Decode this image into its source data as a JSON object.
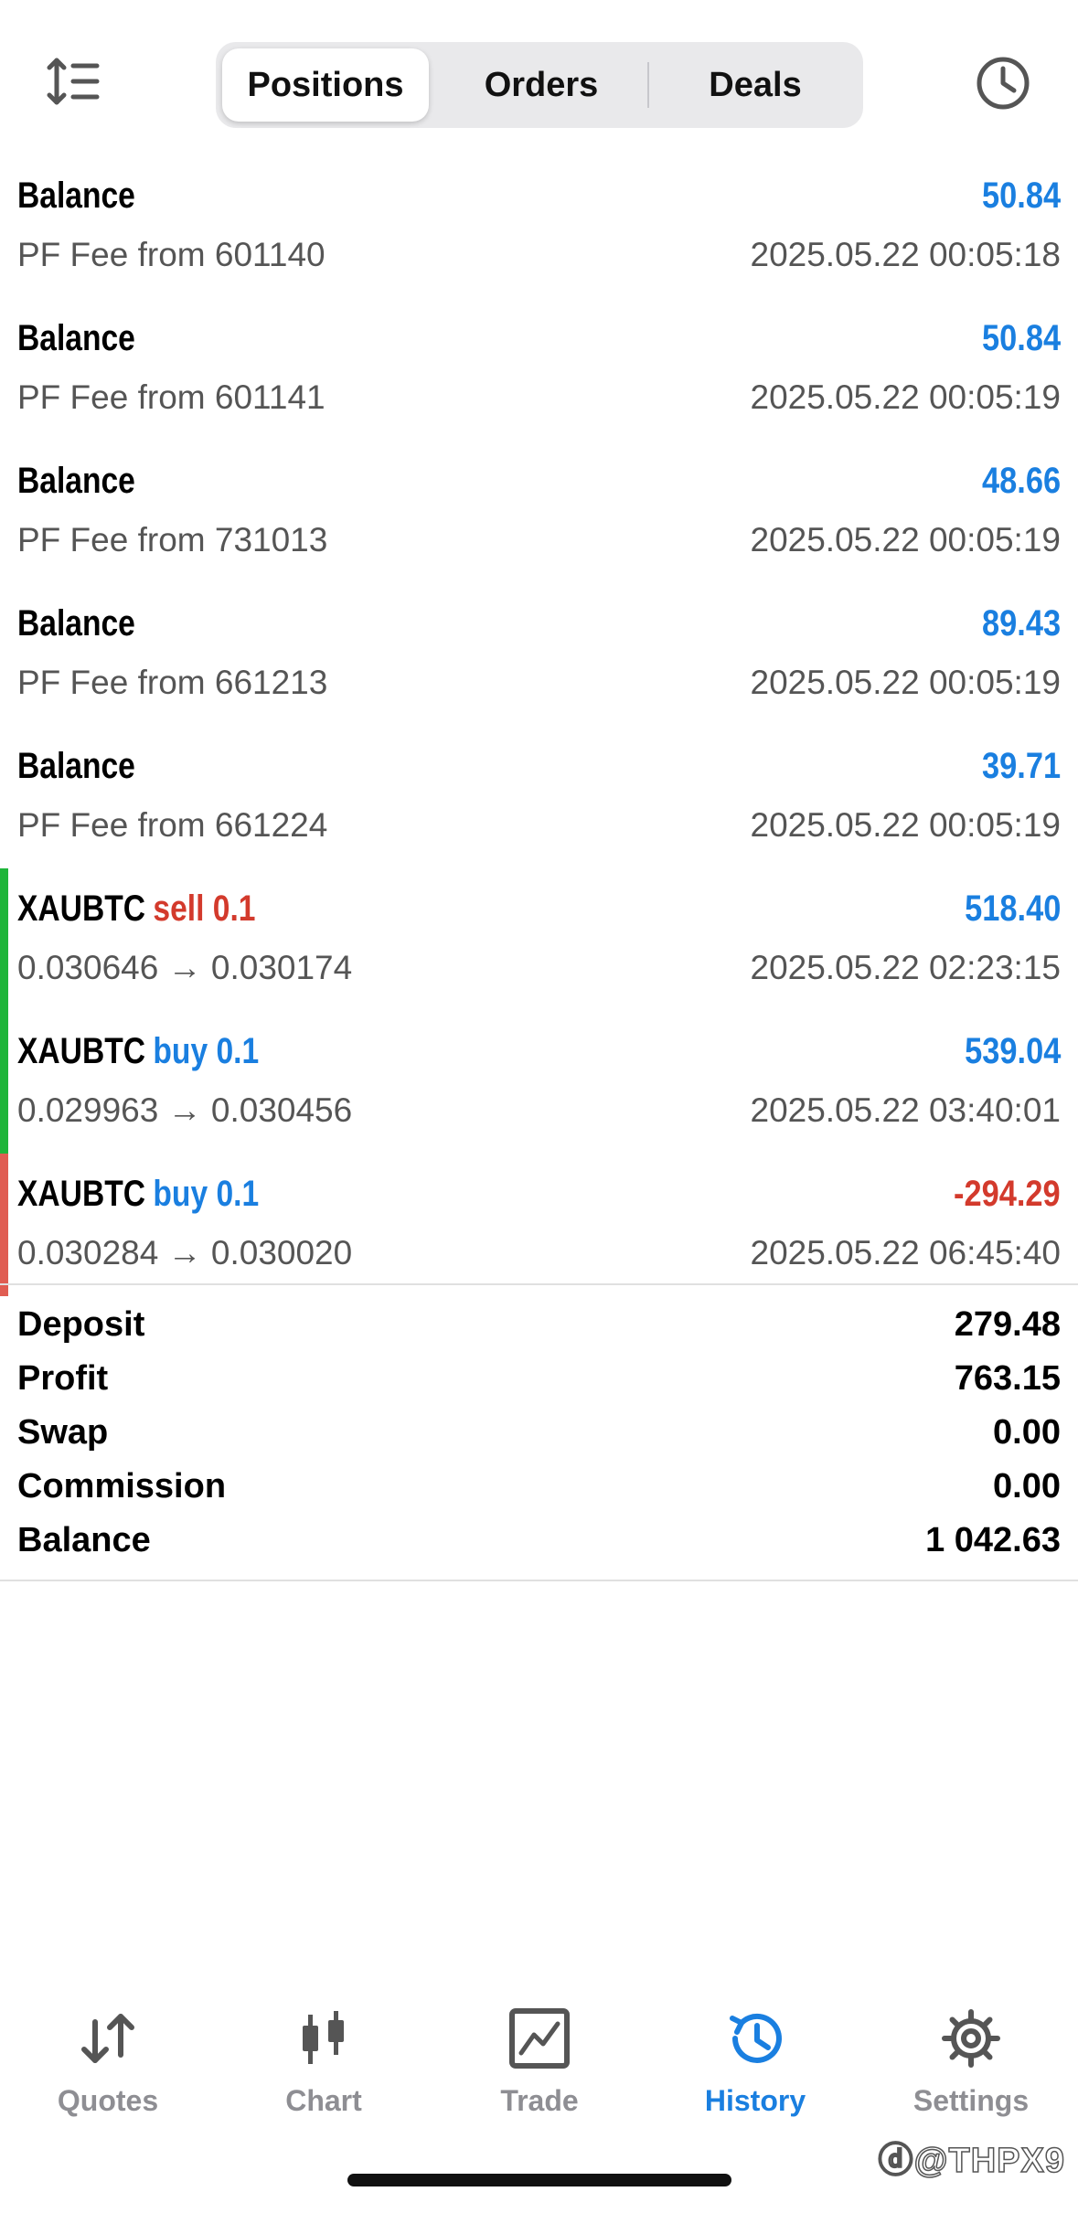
{
  "tabs": [
    {
      "label": "Positions",
      "active": true
    },
    {
      "label": "Orders",
      "active": false
    },
    {
      "label": "Deals",
      "active": false
    }
  ],
  "rows": [
    {
      "title": "Balance",
      "sub": "PF Fee from 601140",
      "amount": "50.84",
      "time": "2025.05.22 00:05:18"
    },
    {
      "title": "Balance",
      "sub": "PF Fee from 601141",
      "amount": "50.84",
      "time": "2025.05.22 00:05:19"
    },
    {
      "title": "Balance",
      "sub": "PF Fee from 731013",
      "amount": "48.66",
      "time": "2025.05.22 00:05:19"
    },
    {
      "title": "Balance",
      "sub": "PF Fee from 661213",
      "amount": "89.43",
      "time": "2025.05.22 00:05:19"
    },
    {
      "title": "Balance",
      "sub": "PF Fee from 661224",
      "amount": "39.71",
      "time": "2025.05.22 00:05:19"
    },
    {
      "title": "XAUBTC",
      "side": "sell 0.1",
      "sub": "0.030646 → 0.030174",
      "amount": "518.40",
      "time": "2025.05.22 02:23:15"
    },
    {
      "title": "XAUBTC",
      "side": "buy 0.1",
      "sub": "0.029963 → 0.030456",
      "amount": "539.04",
      "time": "2025.05.22 03:40:01"
    },
    {
      "title": "XAUBTC",
      "side": "buy 0.1",
      "sub": "0.030284 → 0.030020",
      "amount": "-294.29",
      "time": "2025.05.22 06:45:40"
    }
  ],
  "summary": [
    {
      "label": "Deposit",
      "value": "279.48"
    },
    {
      "label": "Profit",
      "value": "763.15"
    },
    {
      "label": "Swap",
      "value": "0.00"
    },
    {
      "label": "Commission",
      "value": "0.00"
    },
    {
      "label": "Balance",
      "value": "1 042.63"
    }
  ],
  "nav": [
    {
      "label": "Quotes",
      "icon": "quotes-arrows-icon"
    },
    {
      "label": "Chart",
      "icon": "candlestick-icon"
    },
    {
      "label": "Trade",
      "icon": "trade-chart-icon"
    },
    {
      "label": "History",
      "icon": "history-clock-icon",
      "active": true
    },
    {
      "label": "Settings",
      "icon": "gear-icon"
    }
  ],
  "watermark": "ⓓ@THPX9",
  "colors": {
    "profit_blue": "#1a7fe0",
    "loss_red": "#d33a2c",
    "win_bar_green": "#1fb53a",
    "loss_bar_red": "#e05d52"
  }
}
